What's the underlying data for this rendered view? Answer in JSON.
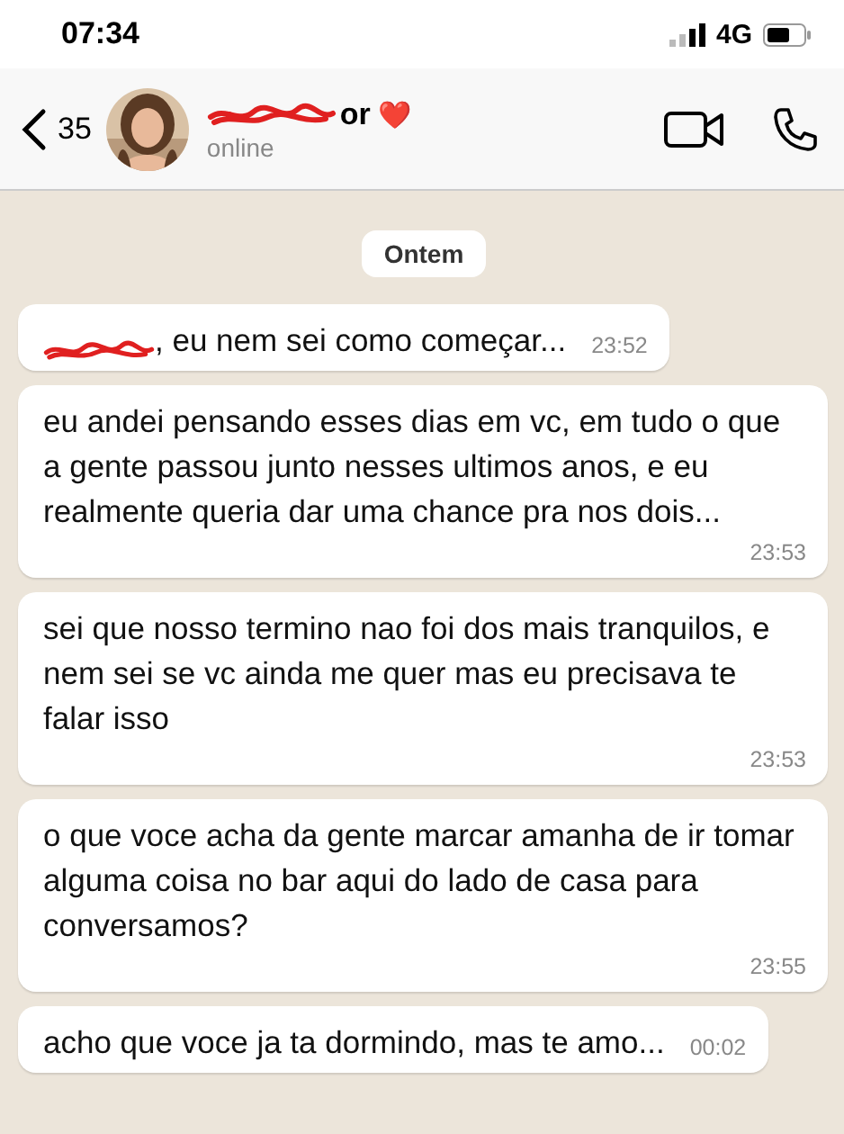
{
  "status_bar": {
    "time": "07:34",
    "network": "4G"
  },
  "header": {
    "back_count": "35",
    "name_redacted": true,
    "name": "or",
    "emoji": "❤️",
    "status": "online"
  },
  "date_label": "Ontem",
  "messages": [
    {
      "redacted_start": true,
      "text": ", eu nem sei como começar...",
      "time": "23:52"
    },
    {
      "redacted_start": false,
      "text": "eu andei pensando esses dias em vc, em tudo o que a gente passou junto nesses ultimos anos, e eu realmente queria dar uma chance pra nos dois...",
      "time": "23:53"
    },
    {
      "redacted_start": false,
      "text": "sei que nosso termino nao foi dos mais tranquilos, e nem sei se vc ainda me quer mas eu precisava te falar isso",
      "time": "23:53"
    },
    {
      "redacted_start": false,
      "text": "o que voce acha da gente marcar amanha de ir tomar alguma coisa no bar aqui do lado de casa para conversamos?",
      "time": "23:55"
    },
    {
      "redacted_start": false,
      "text": "acho que voce ja ta dormindo, mas te amo...",
      "time": "00:02"
    }
  ]
}
